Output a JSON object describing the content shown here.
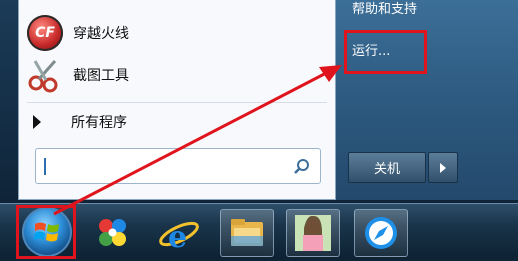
{
  "start_menu": {
    "programs": [
      {
        "label": "穿越火线",
        "icon": "crossfire-game-icon"
      },
      {
        "label": "截图工具",
        "icon": "scissors-icon"
      }
    ],
    "all_programs_label": "所有程序",
    "search": {
      "value": "",
      "icon": "search-icon"
    },
    "right_items": {
      "help": "帮助和支持",
      "run": "运行..."
    },
    "shutdown_label": "关机"
  },
  "logo_text": "CF",
  "taskbar": {
    "items": [
      {
        "icon": "windows-start-orb-icon"
      },
      {
        "icon": "pinwheel-app-icon"
      },
      {
        "icon": "internet-explorer-icon"
      },
      {
        "icon": "file-explorer-folder-icon"
      },
      {
        "icon": "photo-thumbnail-icon"
      },
      {
        "icon": "compass-browser-icon"
      }
    ]
  },
  "colors": {
    "highlight": "#e0141c",
    "menu_right": "#2d5a80",
    "taskbar": "#193349"
  }
}
